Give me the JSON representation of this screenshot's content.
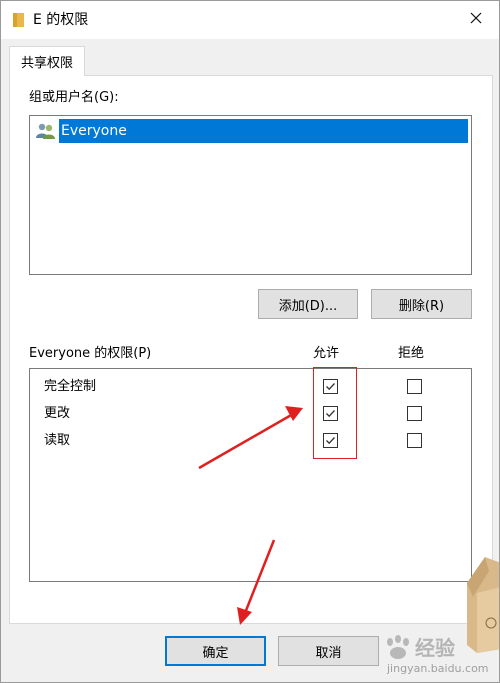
{
  "window": {
    "title": "E 的权限",
    "folder_icon": "folder-icon",
    "close_icon": "close-icon"
  },
  "tabs": [
    {
      "label": "共享权限",
      "selected": true
    }
  ],
  "users": {
    "label": "组或用户名(G):",
    "items": [
      {
        "name": "Everyone",
        "icon": "users-group-icon",
        "selected": true
      }
    ]
  },
  "user_buttons": {
    "add_label": "添加(D)...",
    "remove_label": "删除(R)"
  },
  "permissions": {
    "label": "Everyone 的权限(P)",
    "allow_header": "允许",
    "deny_header": "拒绝",
    "rows": [
      {
        "name": "完全控制",
        "allow": true,
        "deny": false
      },
      {
        "name": "更改",
        "allow": true,
        "deny": false
      },
      {
        "name": "读取",
        "allow": true,
        "deny": false
      }
    ]
  },
  "footer": {
    "ok_label": "确定",
    "cancel_label": "取消"
  },
  "colors": {
    "selection": "#0078d7",
    "annotation": "#e02020",
    "dialog_bg": "#f0f0f0"
  },
  "watermark": {
    "text": "经验",
    "url": "jingyan.baidu.com"
  }
}
